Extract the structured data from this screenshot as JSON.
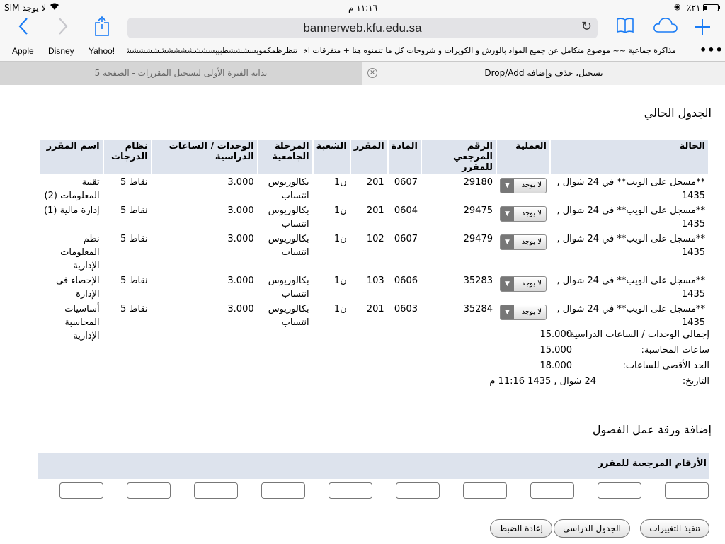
{
  "status": {
    "carrier": "لا يوجد SIM",
    "time": "١١:١٦ م",
    "battery": "٢١٪"
  },
  "toolbar": {
    "url": "bannerweb.kfu.edu.sa"
  },
  "bookmarks": {
    "items": [
      "Apple",
      "Disney",
      "Yahoo!"
    ],
    "folder": "تنظزظمكموبسشششطبيبسششششششششششششششش",
    "long_link": "مذاكرة جماعية ~~ موضوع متكامل عن جميع المواد بالورش و الكويزات و شروحات كل ما تتمنوه هنا + متفرقات اخرى ~~~"
  },
  "tabs": {
    "active": "تسجيل، حذف وإضافة Drop/Add",
    "inactive": "بداية الفترة الأولى لتسجيل المقررات - الصفحة 5"
  },
  "page": {
    "current_heading": "الجدول الحالي",
    "add_heading": "إضافة ورقة عمل الفصول"
  },
  "schedule": {
    "headers": [
      "الحالة",
      "العملية",
      "الرقم المرجعي للمقرر",
      "المادة",
      "المقرر",
      "الشعبة",
      "المرحلة الجامعية",
      "الوحدات / الساعات الدراسية",
      "نظام الدرجات",
      "اسم المقرر"
    ],
    "rows": [
      {
        "status": "**مسجل على الويب** في 24 شوال , 1435",
        "action": "لا يوجد",
        "crn": "29180",
        "subject": "0607",
        "course": "201",
        "section": "ن1",
        "level": "بكالوريوس انتساب",
        "units": "3.000",
        "grading": "نقاط 5",
        "title": "تقنية المعلومات (2)"
      },
      {
        "status": "**مسجل على الويب** في 24 شوال , 1435",
        "action": "لا يوجد",
        "crn": "29475",
        "subject": "0604",
        "course": "201",
        "section": "ن1",
        "level": "بكالوريوس انتساب",
        "units": "3.000",
        "grading": "نقاط 5",
        "title": "إدارة مالية (1)"
      },
      {
        "status": "**مسجل على الويب** في 24 شوال , 1435",
        "action": "لا يوجد",
        "crn": "29479",
        "subject": "0607",
        "course": "102",
        "section": "ن1",
        "level": "بكالوريوس انتساب",
        "units": "3.000",
        "grading": "نقاط 5",
        "title": "نظم المعلومات الإدارية"
      },
      {
        "status": "**مسجل على الويب** في 24 شوال , 1435",
        "action": "لا يوجد",
        "crn": "35283",
        "subject": "0606",
        "course": "103",
        "section": "ن1",
        "level": "بكالوريوس انتساب",
        "units": "3.000",
        "grading": "نقاط 5",
        "title": "الإحصاء في الإدارة"
      },
      {
        "status": "**مسجل على الويب** في 24 شوال , 1435",
        "action": "لا يوجد",
        "crn": "35284",
        "subject": "0603",
        "course": "201",
        "section": "ن1",
        "level": "بكالوريوس انتساب",
        "units": "3.000",
        "grading": "نقاط 5",
        "title": "أساسيات المحاسبة الإدارية"
      }
    ]
  },
  "summary": {
    "total_label": "إجمالي الوحدات / الساعات الدراسية:",
    "total_value": "15.000",
    "billing_label": "ساعات المحاسبة:",
    "billing_value": "15.000",
    "max_label": "الحد الأقصى للساعات:",
    "max_value": "18.000",
    "date_label": "التاريخ:",
    "date_value": "24 شوال , 1435 11:16 م"
  },
  "add_section": {
    "crn_label": "الأرقام المرجعية للمقرر"
  },
  "buttons": {
    "submit": "تنفيذ التغييرات",
    "schedule": "الجدول الدراسي",
    "reset": "إعادة الضبط"
  }
}
